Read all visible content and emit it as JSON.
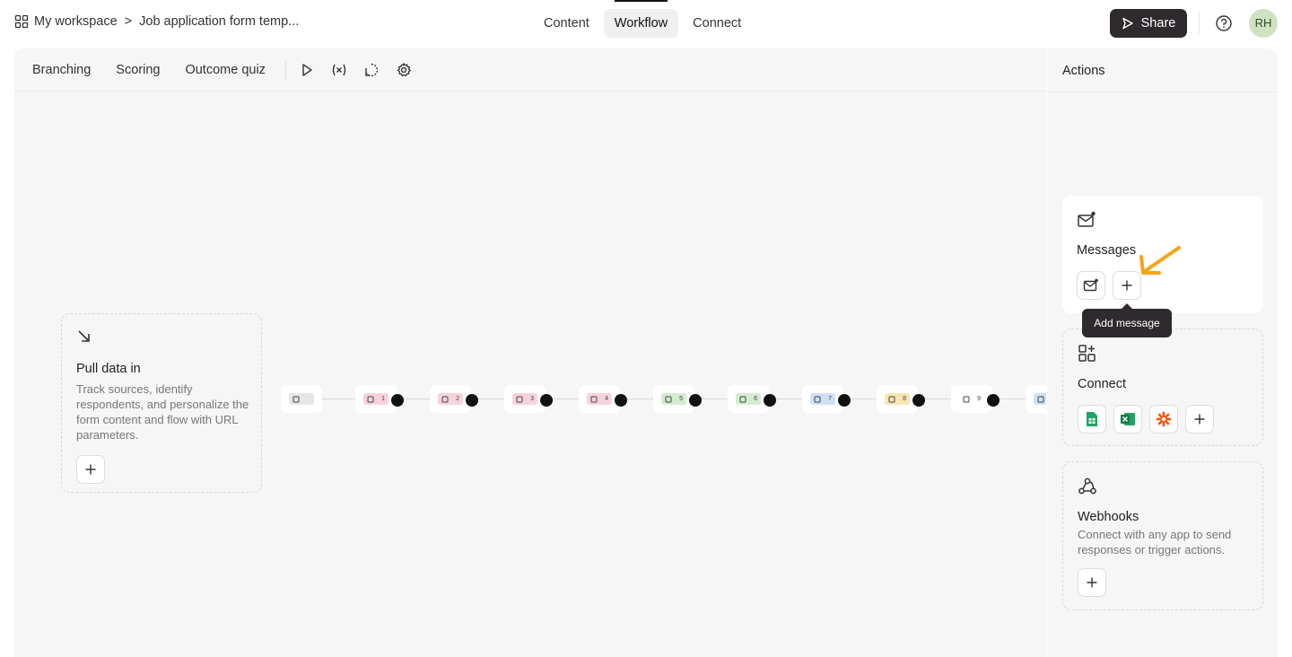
{
  "breadcrumb": {
    "workspace": "My workspace",
    "separator": ">",
    "form": "Job application form temp..."
  },
  "tabs": [
    "Content",
    "Workflow",
    "Connect"
  ],
  "active_tab": "Workflow",
  "share_label": "Share",
  "avatar_initials": "RH",
  "toolbar": {
    "items": [
      "Branching",
      "Scoring",
      "Outcome quiz"
    ]
  },
  "pull": {
    "title": "Pull data in",
    "description": "Track sources, identify respondents, and personalize the form content and flow with URL parameters."
  },
  "flow_nodes": [
    {
      "num": "",
      "color": "#e6e6e6",
      "icon": "toggle-icon"
    },
    {
      "num": "1",
      "color": "#f6d3dc",
      "icon": "contact-icon"
    },
    {
      "num": "2",
      "color": "#f6d3dc",
      "icon": "contact-icon"
    },
    {
      "num": "3",
      "color": "#f6d3dc",
      "icon": "mail-icon"
    },
    {
      "num": "4",
      "color": "#f6d3dc",
      "icon": "phone-icon"
    },
    {
      "num": "5",
      "color": "#d4ebd0",
      "icon": "star-icon"
    },
    {
      "num": "6",
      "color": "#d4ebd0",
      "icon": "chart-icon"
    },
    {
      "num": "7",
      "color": "#cfe0f5",
      "icon": "video-icon"
    },
    {
      "num": "8",
      "color": "#f7e6b0",
      "icon": "upload-icon"
    },
    {
      "num": "9",
      "color": "#ffffff",
      "icon": "radio-icon"
    },
    {
      "num": "",
      "color": "#cfe0f5",
      "icon": "text-icon"
    }
  ],
  "actions": {
    "title": "Actions",
    "messages": {
      "title": "Messages"
    },
    "tooltip": "Add message",
    "connect": {
      "title": "Connect"
    },
    "webhooks": {
      "title": "Webhooks",
      "description": "Connect with any app to send responses or trigger actions."
    }
  },
  "colors": {
    "accent_arrow": "#f5a31a",
    "dark": "#2e2a2e",
    "avatar_bg": "#cfe2c2"
  }
}
